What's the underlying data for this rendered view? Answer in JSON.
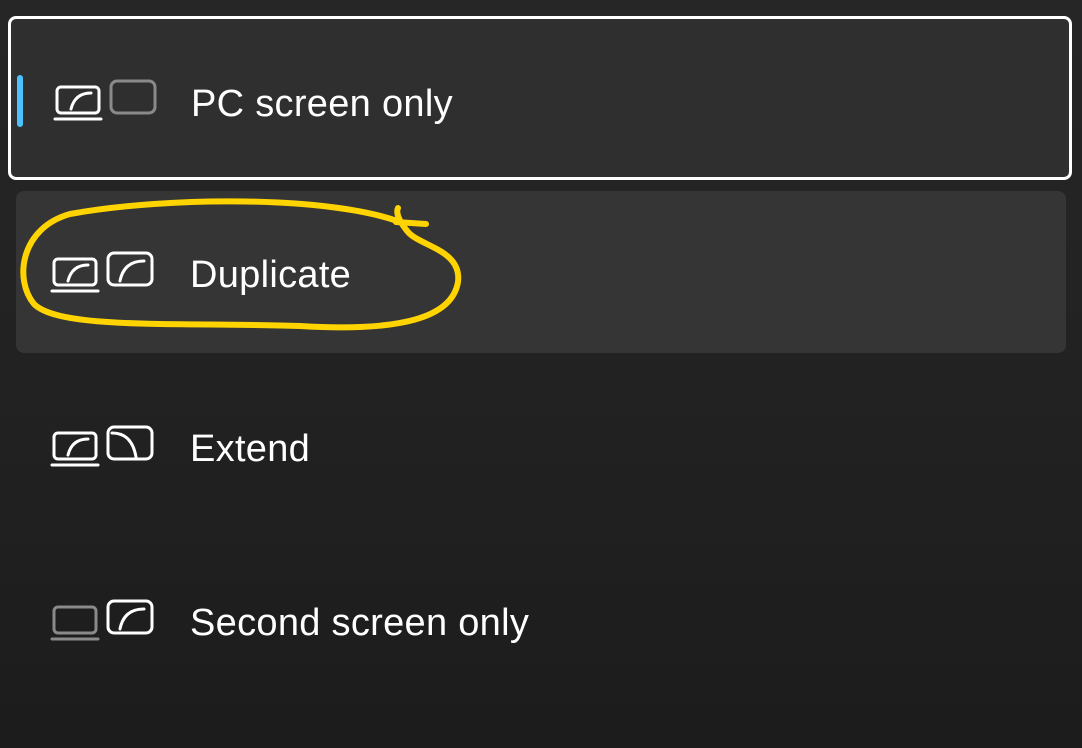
{
  "colors": {
    "accent": "#4cc2ff",
    "highlight_ink": "#ffd400",
    "text": "#ffffff",
    "dim_icon": "#8a8a8a"
  },
  "options": [
    {
      "label": "PC screen only",
      "state": "selected",
      "icon": "pc-screen-only-icon"
    },
    {
      "label": "Duplicate",
      "state": "hover",
      "icon": "duplicate-icon",
      "annotated": true
    },
    {
      "label": "Extend",
      "state": "normal",
      "icon": "extend-icon"
    },
    {
      "label": "Second screen only",
      "state": "normal",
      "icon": "second-screen-only-icon"
    }
  ]
}
